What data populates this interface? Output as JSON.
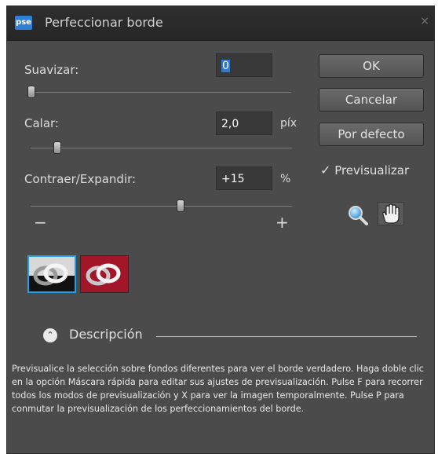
{
  "window": {
    "app_icon_text": "pse",
    "title": "Perfeccionar borde",
    "close_symbol": "×"
  },
  "controls": {
    "smooth": {
      "label": "Suavizar:",
      "value": "0",
      "slider_fraction": 0.0
    },
    "feather": {
      "label": "Calar:",
      "value": "2,0",
      "unit": "píx",
      "slider_fraction": 0.1
    },
    "contract_expand": {
      "label": "Contraer/Expandir:",
      "value": "+15",
      "unit": "%",
      "slider_fraction": 0.575,
      "minus_symbol": "−",
      "plus_symbol": "+"
    }
  },
  "buttons": {
    "ok": "OK",
    "cancel": "Cancelar",
    "default": "Por defecto"
  },
  "preview": {
    "checked": true,
    "check_symbol": "✓",
    "label": "Previsualizar"
  },
  "tools": [
    "zoom-icon",
    "hand-icon"
  ],
  "view_modes": [
    {
      "name": "black-white",
      "selected": true
    },
    {
      "name": "overlay",
      "selected": false
    }
  ],
  "description": {
    "toggle_symbol": "⌃",
    "label": "Descripción",
    "text": "Previsualice la selección sobre fondos diferentes para ver el borde verdadero. Haga doble clic en la opción Máscara rápida para editar sus ajustes de previsualización. Pulse F para recorrer todos los modos de previsualización y X para ver la imagen temporalmente. Pulse P para conmutar la previsualización de los perfeccionamientos del borde."
  },
  "colors": {
    "dialog_bg": "#4b4b4b",
    "titlebar_bg": "#2b2b2b",
    "field_bg": "#393939",
    "selection_accent": "#1ea1e8",
    "overlay_red": "#a3162a"
  }
}
